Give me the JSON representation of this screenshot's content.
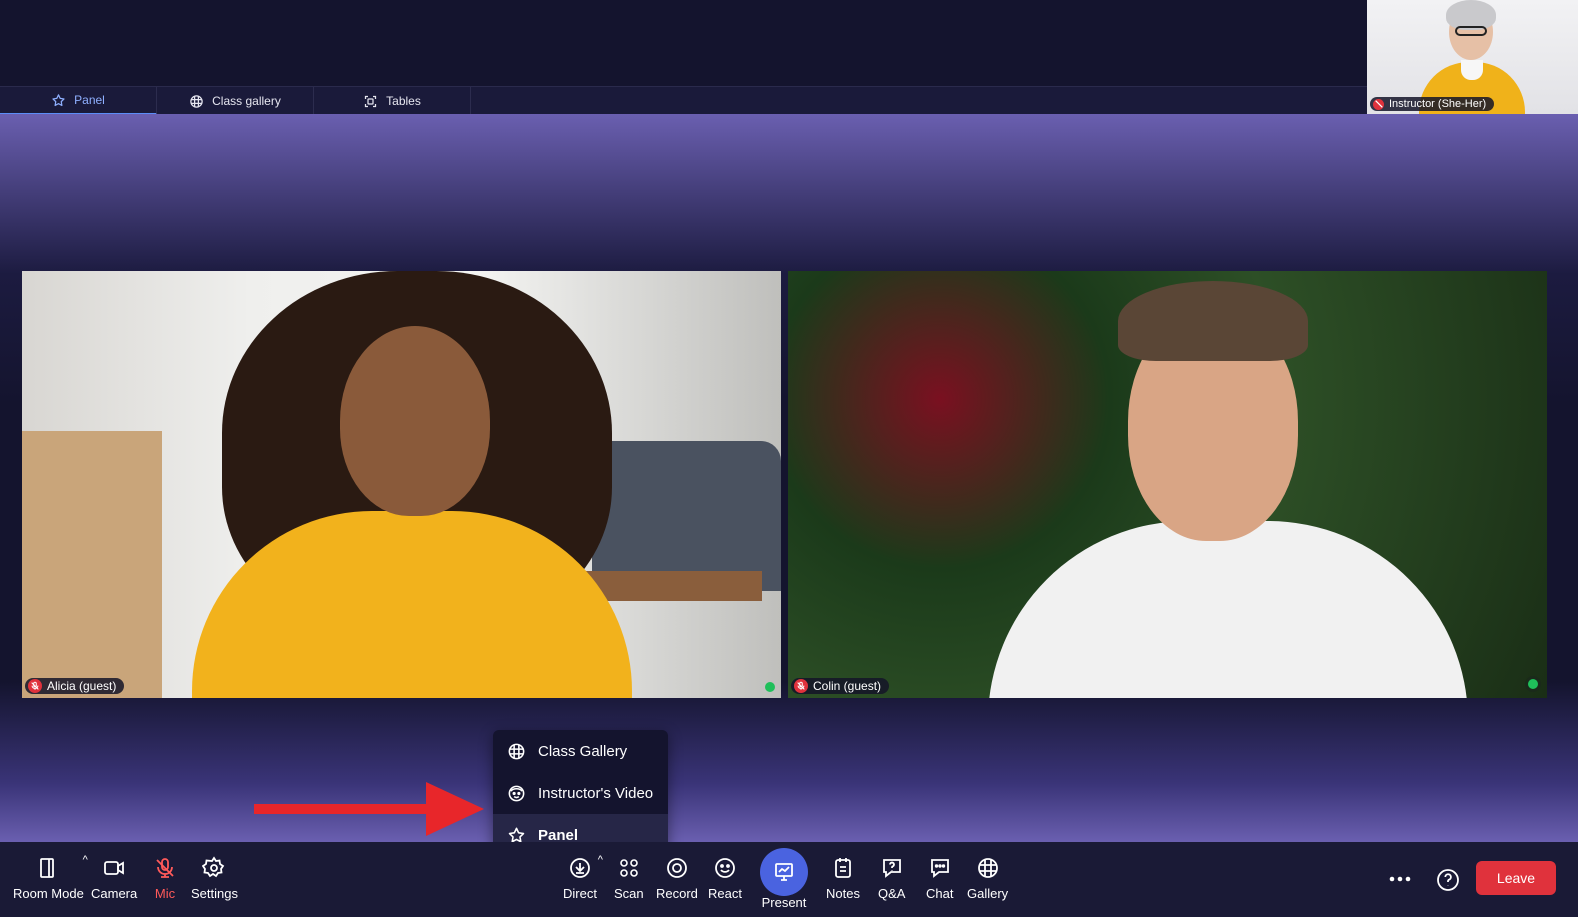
{
  "tabs": [
    {
      "label": "Panel",
      "icon": "star-icon",
      "active": true
    },
    {
      "label": "Class gallery",
      "icon": "grid-icon",
      "active": false
    },
    {
      "label": "Tables",
      "icon": "tables-icon",
      "active": false
    }
  ],
  "instructor": {
    "name": "Instructor (She-Her)",
    "mic_muted": true
  },
  "participants": [
    {
      "name": "Alicia (guest)",
      "mic_muted": true,
      "status_color": "#1fbf5a"
    },
    {
      "name": "Colin (guest)",
      "mic_muted": true,
      "status_color": "#1fbf5a"
    }
  ],
  "view_menu": {
    "items": [
      {
        "label": "Class Gallery",
        "icon": "grid-icon",
        "selected": false
      },
      {
        "label": "Instructor's Video",
        "icon": "instructor-face-icon",
        "selected": false
      },
      {
        "label": "Panel",
        "icon": "star-icon",
        "selected": true
      }
    ]
  },
  "annotation": {
    "arrow_color": "#e8262a"
  },
  "toolbar": {
    "room_mode": "Room Mode",
    "camera": "Camera",
    "mic": "Mic",
    "settings": "Settings",
    "direct": "Direct",
    "scan": "Scan",
    "record": "Record",
    "react": "React",
    "present": "Present",
    "notes": "Notes",
    "qa": "Q&A",
    "chat": "Chat",
    "gallery": "Gallery",
    "leave": "Leave"
  },
  "colors": {
    "accent": "#4a63e0",
    "leave": "#e0323c",
    "mic_muted": "#ff5a5a",
    "active_tab": "#8fb0ff"
  }
}
